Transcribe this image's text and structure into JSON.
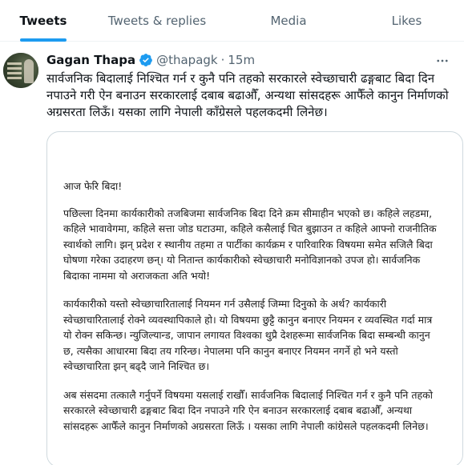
{
  "tabs": {
    "tweets": "Tweets",
    "replies": "Tweets & replies",
    "media": "Media",
    "likes": "Likes"
  },
  "tweet": {
    "name": "Gagan Thapa",
    "handle": "@thapagk",
    "separator": "·",
    "time": "15m",
    "more_icon": "ellipsis-icon",
    "verified_icon": "verified-badge-icon",
    "text": "सार्वजनिक बिदालाई निश्चित गर्न र कुनै पनि तहको सरकारले स्वेच्छाचारी ढङ्गबाट बिदा दिन नपाउने गरी ऐन बनाउन सरकारलाई दबाब बढाऔँ, अन्यथा सांसदहरू आफैँले कानुन निर्माणको अग्रसरता लिऊँ। यसका लागि नेपाली काँग्रेसले पहलकदमी लिनेछ।"
  },
  "document": {
    "title": "आज फेरि बिदा!",
    "paragraphs": [
      "पछिल्ला दिनमा कार्यकारीको तजबिजमा सार्वजनिक बिदा दिने क्रम सीमाहीन भएको छ। कहिले लहडमा, कहिले भावावेगमा, कहिले सत्ता जोड घटाउमा, कहिले कसैलाई चित बुझाउन त कहिले आफ्नो राजनीतिक स्वार्थको लागि। झन् प्रदेश र स्थानीय तहमा त पार्टीका कार्यक्रम र पारिवारिक विषयमा समेत सजिलै बिदा घोषणा गरेका उदाहरण छन्। यो नितान्त कार्यकारीको स्वेच्छाचारी मनोविज्ञानको उपज हो। सार्वजनिक बिदाका नाममा यो अराजकता अति भयो!",
      "कार्यकारीको यस्तो स्वेच्छाचारितालाई नियमन गर्न उसैलाई जिम्मा दिनुको के अर्थ? कार्यकारी स्वेच्छाचारितालाई रोक्ने व्यवस्थापिकाले हो। यो विषयमा छुट्टै कानुन बनाएर नियमन र व्यवस्थित गर्दा मात्र यो रोक्न सकिन्छ। न्युजिल्यान्ड, जापान लगायत विश्वका थुप्रै देशहरूमा सार्वजनिक बिदा सम्बन्धी कानुन छ, त्यसैका आधारमा बिदा तय गरिन्छ। नेपालमा पनि कानुन बनाएर नियमन नगर्ने हो भने यस्तो स्वेच्छाचारिता झन् बढ्दै जाने निश्चित छ।",
      "अब संसदमा तत्कालै गर्नुपर्ने विषयमा यसलाई राखौँ। सार्वजनिक बिदालाई निश्चित गर्न र कुनै पनि तहको सरकारले स्वेच्छाचारी ढङ्गबाट बिदा दिन नपाउने गरि ऐन बनाउन सरकारलाई दबाब बढाऔँ, अन्यथा सांसदहरू आफैँले कानुन निर्माणको अग्रसरता लिऊँ । यसका लागि नेपाली कांग्रेसले पहलकदमी लिनेछ।"
    ]
  },
  "colors": {
    "accent": "#1d9bf0",
    "text_primary": "#0f1419",
    "text_secondary": "#536471",
    "border": "#cfd9de"
  }
}
